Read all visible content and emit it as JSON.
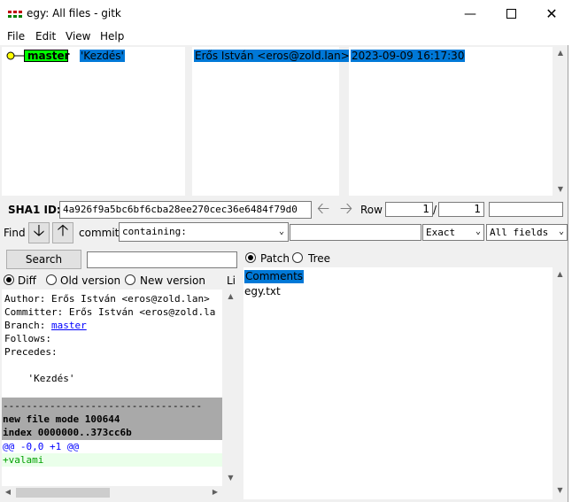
{
  "window": {
    "title": "egy: All files - gitk"
  },
  "menu": [
    "File",
    "Edit",
    "View",
    "Help"
  ],
  "commit_list": {
    "branch": "master",
    "subject": "'Kezdés'",
    "author": "Erős István <eros@zold.lan>",
    "date": "2023-09-09 16:17:30"
  },
  "sha": {
    "label": "SHA1 ID:",
    "value": "4a926f9a5bc6bf6cba28ee270cec36e6484f79d0"
  },
  "row": {
    "label": "Row",
    "current": "1",
    "sep": "/",
    "total": "1"
  },
  "find": {
    "label": "Find",
    "commit_label": "commit",
    "containing": "containing:",
    "match": "Exact",
    "fields": "All fields"
  },
  "search": {
    "button": "Search"
  },
  "diff_options": {
    "diff": "Diff",
    "old": "Old version",
    "new": "New version",
    "lines": "Li"
  },
  "tree_options": {
    "patch": "Patch",
    "tree": "Tree"
  },
  "details": {
    "author_line": "Author: Erős István <eros@zold.lan>",
    "committer_line": "Committer: Erős István <eros@zold.la",
    "branch_label": "Branch: ",
    "branch_link": "master",
    "follows": "Follows:",
    "precedes": "Precedes:",
    "message": "    'Kezdés'",
    "dashes": "----------------------------------",
    "new_file": "new file mode 100644",
    "index": "index 0000000..373cc6b",
    "hunk": "@@ -0,0 +1 @@",
    "added": "+valami"
  },
  "files": {
    "comments": "Comments",
    "file1": "egy.txt"
  },
  "colors": {
    "selection": "#0078d7",
    "branch_tag": "#00ff00",
    "node": "#ffff00",
    "hunk": "#0000ff",
    "added": "#00a000",
    "header_bg": "#a9a9a9"
  }
}
